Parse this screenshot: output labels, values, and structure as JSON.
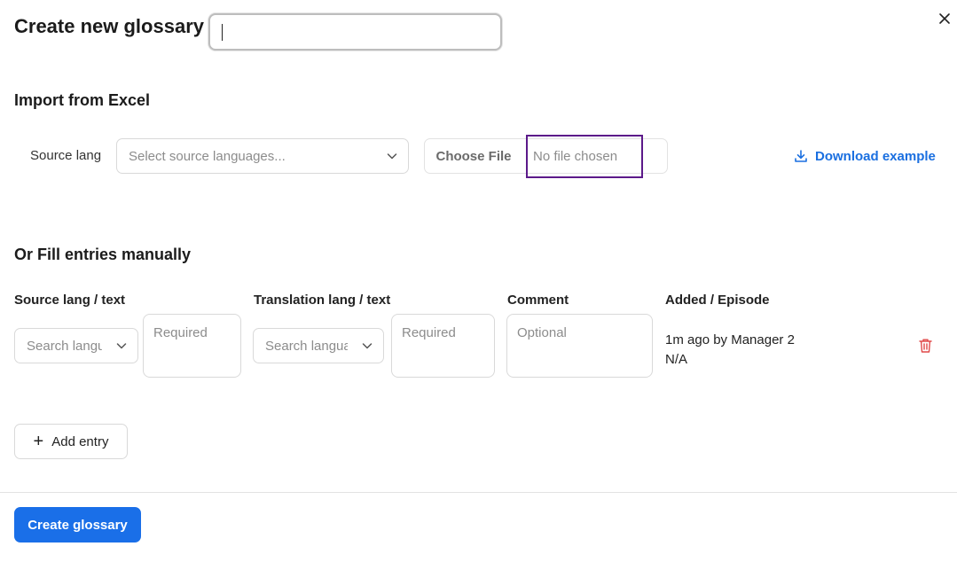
{
  "dialog": {
    "title": "Create new glossary",
    "name_input_value": ""
  },
  "import_section": {
    "heading": "Import from Excel",
    "source_lang_label": "Source lang",
    "source_select_placeholder": "Select source languages...",
    "choose_file_label": "Choose File",
    "no_file_text": "No file chosen",
    "download_label": "Download example"
  },
  "manual_section": {
    "heading": "Or Fill entries manually",
    "columns": [
      "Source lang / text",
      "Translation lang / text",
      "Comment",
      "Added / Episode"
    ],
    "entry": {
      "source_lang_placeholder": "Search languages",
      "source_text_placeholder": "Required",
      "translation_lang_placeholder": "Search languages",
      "translation_text_placeholder": "Required",
      "comment_placeholder": "Optional",
      "added_by": "1m ago by Manager 2",
      "episode": "N/A"
    },
    "add_entry_label": "Add entry"
  },
  "footer": {
    "create_label": "Create glossary"
  },
  "colors": {
    "primary": "#1a6fe8",
    "link": "#1a6fe0",
    "danger": "#e04848",
    "highlight": "#5c1a8a"
  }
}
